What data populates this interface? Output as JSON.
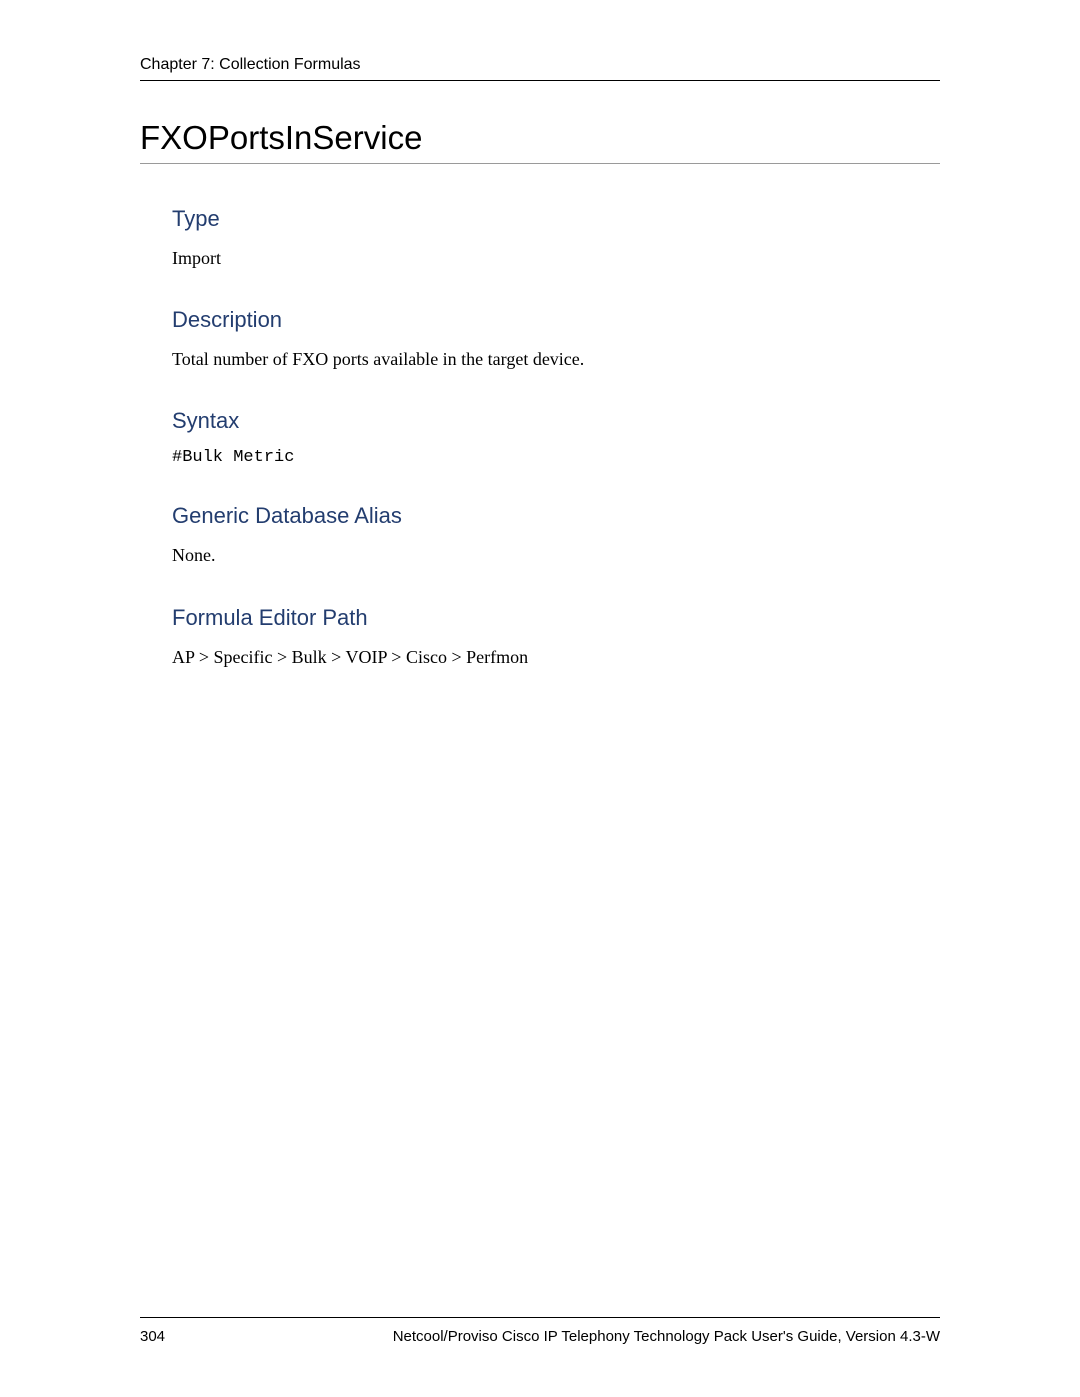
{
  "header": {
    "chapter": "Chapter 7: Collection Formulas"
  },
  "title": "FXOPortsInService",
  "sections": {
    "type": {
      "heading": "Type",
      "body": "Import"
    },
    "description": {
      "heading": "Description",
      "body": "Total number of FXO ports available in the target device."
    },
    "syntax": {
      "heading": "Syntax",
      "body": "#Bulk Metric"
    },
    "alias": {
      "heading": "Generic Database Alias",
      "body": "None."
    },
    "path": {
      "heading": "Formula Editor Path",
      "body": "AP > Specific > Bulk > VOIP > Cisco > Perfmon"
    }
  },
  "footer": {
    "page_number": "304",
    "doc_title": "Netcool/Proviso Cisco IP Telephony Technology Pack User's Guide, Version 4.3-W"
  }
}
